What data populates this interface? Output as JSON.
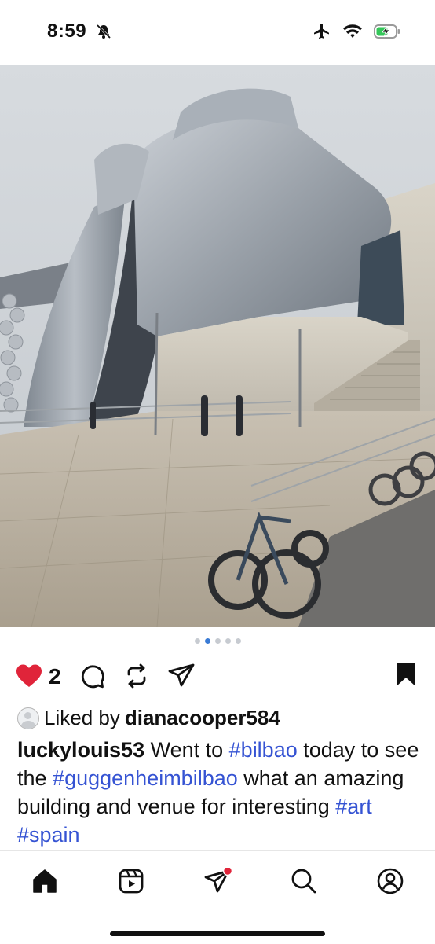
{
  "status_bar": {
    "time": "8:59"
  },
  "post": {
    "carousel": {
      "count": 5,
      "active_index": 1
    },
    "likes_count": "2",
    "liked_by_prefix": "Liked by",
    "liked_by_user": "dianacooper584",
    "caption": {
      "username": "luckylouis53",
      "text_1": " Went to ",
      "tag_1": "#bilbao",
      "text_2": " today to see the ",
      "tag_2": "#guggenheimbilbao",
      "text_3": " what an amazing building and venue for interesting ",
      "tag_3": "#art",
      "text_4": " ",
      "tag_4": "#spain"
    }
  },
  "colors": {
    "like": "#e0243a",
    "hashtag": "#3553d3",
    "notification_dot": "#e0243a"
  },
  "tab_bar": {
    "icons": [
      "home-icon",
      "reels-icon",
      "direct-icon",
      "search-icon",
      "profile-icon"
    ]
  }
}
